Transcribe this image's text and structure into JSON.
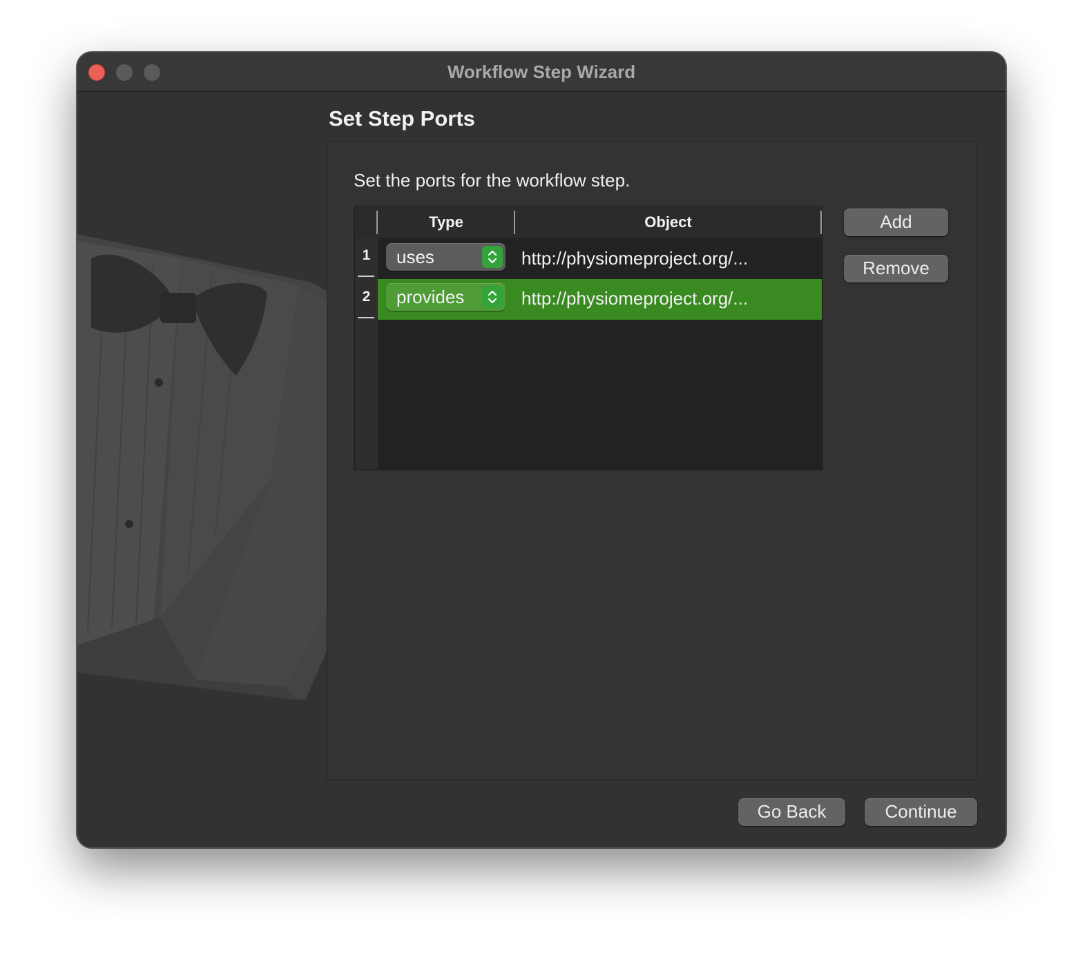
{
  "window": {
    "title": "Workflow Step Wizard"
  },
  "page": {
    "title": "Set Step Ports",
    "subtitle": "Set the ports for the workflow step."
  },
  "table": {
    "columns": [
      "Type",
      "Object"
    ],
    "rows": [
      {
        "number": "1",
        "type": "uses",
        "object": "http://physiomeproject.org/...",
        "selected": false
      },
      {
        "number": "2",
        "type": "provides",
        "object": "http://physiomeproject.org/...",
        "selected": true
      }
    ]
  },
  "side_buttons": {
    "add_label": "Add",
    "remove_label": "Remove"
  },
  "footer": {
    "back_label": "Go Back",
    "continue_label": "Continue"
  },
  "icons": {
    "close": "close-dot",
    "minimize": "minimize-dot",
    "maximize": "maximize-dot",
    "combo": "up-down-chevron-icon",
    "watermark": "tuxedo-bowtie-icon"
  },
  "colors": {
    "selection": "#3a8a22",
    "combo_arrows": "#33a33a",
    "close": "#ec5f57"
  }
}
